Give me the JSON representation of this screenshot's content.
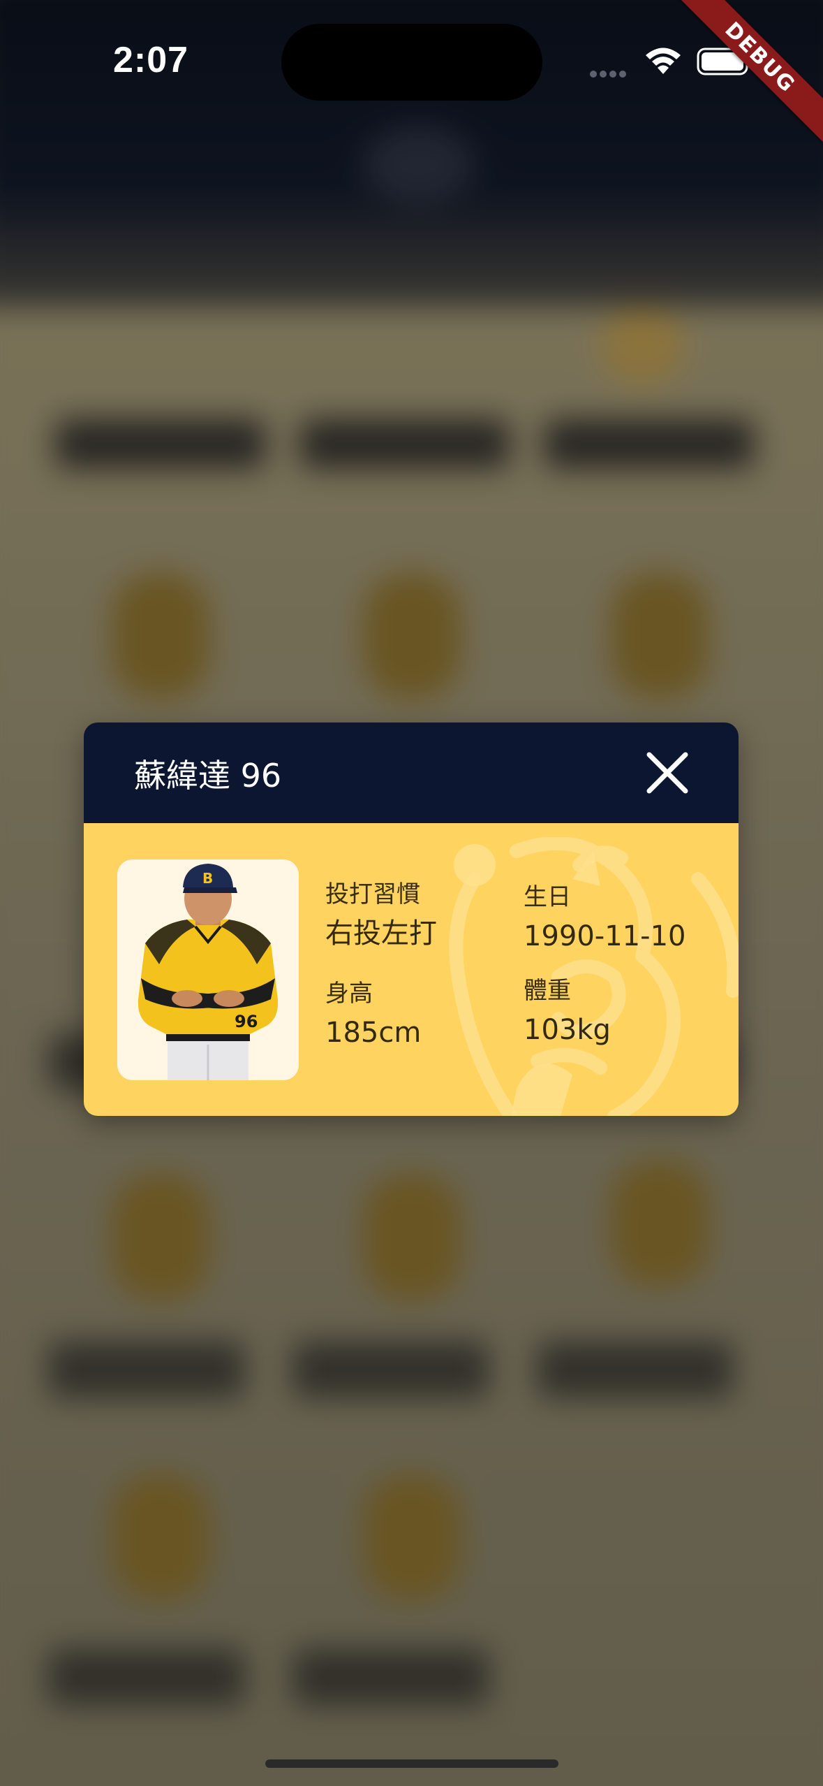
{
  "status_bar": {
    "time": "2:07",
    "icons": [
      "cellular-signal-icon",
      "wifi-icon",
      "battery-icon"
    ]
  },
  "debug_banner": {
    "label": "DEBUG",
    "color": "#8b1a1a"
  },
  "player_modal": {
    "title": "蘇緯達 96",
    "close_icon": "close-icon",
    "header_color": "#0c1630",
    "body_color": "#fed35f",
    "photo": {
      "jersey_number": "96",
      "cap_letter": "B"
    },
    "stats": {
      "bats_throws": {
        "label": "投打習慣",
        "value": "右投左打"
      },
      "birthday": {
        "label": "生日",
        "value": "1990-11-10"
      },
      "height": {
        "label": "身高",
        "value": "185cm"
      },
      "weight": {
        "label": "體重",
        "value": "103kg"
      }
    }
  }
}
